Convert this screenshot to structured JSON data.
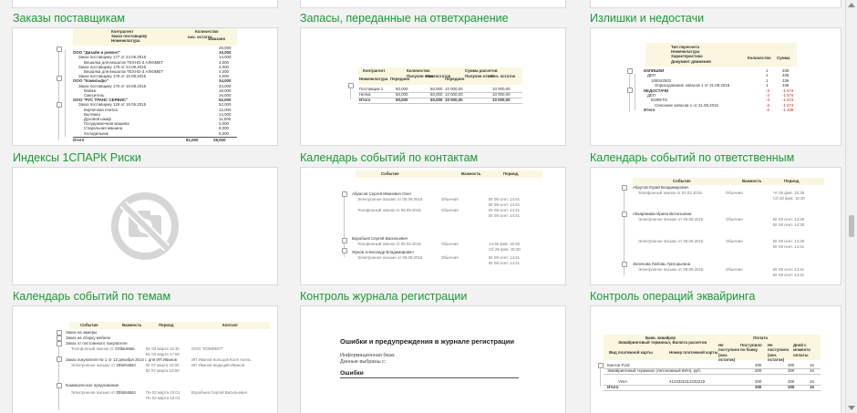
{
  "tiles": [
    {
      "title": "Заказы поставщикам"
    },
    {
      "title": "Запасы, переданные на ответхранение"
    },
    {
      "title": "Излишки и недостачи"
    },
    {
      "title": "Индексы 1СПАРК Риски"
    },
    {
      "title": "Календарь событий по контактам"
    },
    {
      "title": "Календарь событий по ответственным"
    },
    {
      "title": "Календарь событий по темам"
    },
    {
      "title": "Контроль журнала регистрации"
    },
    {
      "title": "Контроль операций эквайринга"
    }
  ],
  "orders": {
    "header": [
      "Контрагент",
      "Заказ поставщику",
      "Номенклатура",
      "Количество",
      "нач. остаток",
      "заказано"
    ],
    "rows": [
      {
        "t": "",
        "v1": "",
        "v2": "28,000"
      },
      {
        "t": "ООО \"Дизайн и ремонт\"",
        "v1": "",
        "v2": "10,000"
      },
      {
        "t": "Заказ поставщику 177 от 24.09.2015",
        "v1": "",
        "v2": "14,000"
      },
      {
        "t": "Вешалка для вешалок ТЕХНО-3 АЛЮМЕТ",
        "v1": "",
        "v2": "4,000"
      },
      {
        "t": "Заказ поставщику 179 от 24.09.2015",
        "v1": "",
        "v2": "4,000"
      },
      {
        "t": "Вешалка для вешалок ТЕХНО-3 АЛЮМЕТ",
        "v1": "",
        "v2": "4,000"
      },
      {
        "t": "Заказ поставщику 178 от 10.08.2015",
        "v1": "",
        "v2": "4,000"
      },
      {
        "t": "ООО \"Комильфо\"",
        "v1": "",
        "v2": "34,000"
      },
      {
        "t": "Заказ поставщику 176 от 10.08.2015",
        "v1": "",
        "v2": "34,000"
      },
      {
        "t": "Мойка",
        "v1": "",
        "v2": "18,000"
      },
      {
        "t": "Смеситель",
        "v1": "",
        "v2": "16,000"
      },
      {
        "t": "ООО \"РУС ТРАНС СЕРВИС\"",
        "v1": "",
        "v2": "52,000"
      },
      {
        "t": "Заказ поставщику 128 от 16.06.2015",
        "v1": "",
        "v2": "52,000"
      },
      {
        "t": "Кирпичная плитка",
        "v1": "",
        "v2": "12,000"
      },
      {
        "t": "Вытяжка",
        "v1": "",
        "v2": "14,000"
      },
      {
        "t": "Духовой шкаф",
        "v1": "",
        "v2": "11,000"
      },
      {
        "t": "Посудомоечная машина",
        "v1": "",
        "v2": "2,000"
      },
      {
        "t": "Стиральная машина",
        "v1": "",
        "v2": "8,000"
      },
      {
        "t": "Холодильник",
        "v1": "",
        "v2": "5,000"
      }
    ],
    "total_label": "Итого",
    "total_1": "81,000",
    "total_2": "28,000"
  },
  "storage": {
    "headers": [
      "Контрагент",
      "Номенклатура",
      "Количество",
      "Передано",
      "Получен ответ",
      "Кон. остаток",
      "Сумма расчетов",
      "Передано",
      "Получен ответ",
      "Кон. остаток"
    ],
    "rows": [
      {
        "t": "Поставщик 1",
        "c": [
          "50,000",
          "",
          "50,000",
          "10 000,00",
          "",
          "10 000,00"
        ]
      },
      {
        "t": "Нелка",
        "c": [
          "50,000",
          "",
          "50,000",
          "10 000,00",
          "",
          "10 000,00"
        ]
      },
      {
        "t": "Итого",
        "c": [
          "50,000",
          "",
          "50,000",
          "10 000,00",
          "",
          "10 000,00"
        ]
      }
    ]
  },
  "surplus": {
    "headers": [
      "Тип пересчета",
      "Номенклатура",
      "Характеристика",
      "Документ движения",
      "Количество",
      "Сумма"
    ],
    "rows": [
      {
        "t": "ИЗЛИШКИ",
        "q": "1",
        "s": "336",
        "neg": false
      },
      {
        "t": "ДЕП",
        "q": "1",
        "s": "336",
        "neg": false
      },
      {
        "t": "100042503",
        "q": "1",
        "s": "336",
        "neg": false
      },
      {
        "t": "Оприходование запасов 1 от 21.08.2015",
        "q": "1",
        "s": "336",
        "neg": false
      },
      {
        "t": "НЕДОСТАЧИ",
        "q": "-3",
        "s": "-1 674",
        "neg": true
      },
      {
        "t": "ДЕП",
        "q": "-3",
        "s": "-1 674",
        "neg": true
      },
      {
        "t": "КОФЕТО",
        "q": "-3",
        "s": "-1 674",
        "neg": true
      },
      {
        "t": "Списание запасов 1 от 21.08.2015",
        "q": "-3",
        "s": "-1 674",
        "neg": true
      },
      {
        "t": "Итого",
        "q": "-2",
        "s": "-1 338",
        "neg": true
      }
    ]
  },
  "contacts": {
    "headers": [
      "Событие",
      "Важность",
      "Период"
    ],
    "rows": [
      {
        "t": "Абрасов Сергей Иванович Олег",
        "i": "",
        "p": ""
      },
      {
        "t": "Электронное письмо от 05.09.2015",
        "i": "Обычная",
        "p": "Вт 08 сент. 14:41"
      },
      {
        "t": "",
        "i": "",
        "p": "Вт 08 сент. 14:41"
      },
      {
        "t": "Телефонный звонок от 05.09.2015",
        "i": "Обычная",
        "p": "Вт 08 сент. 14:41"
      },
      {
        "t": "",
        "i": "",
        "p": "Вт 08 сент. 14:41"
      },
      {
        "t": "Воробьев Сергей Васильевич",
        "i": "",
        "p": ""
      },
      {
        "t": "Телефонный звонок от 05.02.2015",
        "i": "Обычная",
        "p": "14:35 фев. 15:30"
      },
      {
        "t": "",
        "i": "",
        "p": "Сб 28 фев. 15:30"
      },
      {
        "t": "Жуков Александр Владимирович",
        "i": "",
        "p": ""
      },
      {
        "t": "Электронное письмо от 09.09.2015",
        "i": "Обычная",
        "p": "Вт 08 сент. 14:41"
      },
      {
        "t": "",
        "i": "",
        "p": "Вт 08 сент. 14:41"
      }
    ]
  },
  "responsible": {
    "headers": [
      "Событие",
      "Важность",
      "Период"
    ],
    "rows": [
      {
        "t": "Абрутов Юрий Владимирович",
        "i": "",
        "p": ""
      },
      {
        "t": "Телефонный звонок от 02.02.2015",
        "i": "Обычная",
        "p": "Чт 05 фев. 15:35"
      },
      {
        "t": "",
        "i": "",
        "p": "Сб 28 фев. 15:30"
      },
      {
        "t": "Абкарямова Ирина Витальевна",
        "i": "",
        "p": ""
      },
      {
        "t": "Электронное письмо от 09.09.2015",
        "i": "Обычная",
        "p": "Вт 08 сент. 14:35"
      },
      {
        "t": "",
        "i": "",
        "p": "Вт 08 сент. 14:35"
      },
      {
        "t": "Электронное письмо от 09.09.2015",
        "i": "Обычная",
        "p": "Вт 08 сент. 14:35"
      },
      {
        "t": "",
        "i": "",
        "p": "Вт 08 сент. 14:41"
      },
      {
        "t": "Зеленова Любовь Григорьевна",
        "i": "",
        "p": ""
      },
      {
        "t": "Электронное письмо от 09.09.2015",
        "i": "Обычная",
        "p": "Вт 08 сент. 14:41"
      },
      {
        "t": "",
        "i": "",
        "p": "Вт 08 сент. 14:41"
      }
    ]
  },
  "topics": {
    "headers": [
      "Событие",
      "Важность",
      "Период",
      "Контакт"
    ],
    "rows": [
      {
        "t": "Заказ на замеры",
        "i": "",
        "p": "",
        "c": ""
      },
      {
        "t": "Заказ на сборку мебели",
        "i": "",
        "p": "",
        "c": ""
      },
      {
        "t": "Заказ от постоянного покупателя",
        "i": "",
        "p": "",
        "c": ""
      },
      {
        "t": "Телефонный звонок от 07.03.2015",
        "i": "Обычная",
        "p": "Вс 03 марта 15:30",
        "c": "ООО \"КОМЛЕКТ\""
      },
      {
        "t": "",
        "i": "",
        "p": "Вс 03 марта 17:00",
        "c": ""
      },
      {
        "t": "Заказ покупателя № 1 от 12 декабря 2014 г. для ИП Иванов",
        "i": "",
        "p": "",
        "c": "ИП Иванов Кольцов Коля Асель"
      },
      {
        "t": "Электронное письмо от 10.07.2015",
        "i": "Обычная",
        "p": "Вт 07 марта 10:00",
        "c": "ИП Иванов ведущий Иванов"
      },
      {
        "t": "",
        "i": "",
        "p": "Вт 07 марта 10:00",
        "c": ""
      },
      {
        "t": "Коммерческое предложение",
        "i": "",
        "p": "",
        "c": ""
      },
      {
        "t": "Электронное письмо от 02.03.2015",
        "i": "Обычная",
        "p": "Пн 02 марта 10:01",
        "c": "Воробьев Сергей Васильевич"
      },
      {
        "t": "",
        "i": "",
        "p": "Пн 02 марта 10:01",
        "c": ""
      }
    ]
  },
  "journal": {
    "heading": "Ошибки и предупреждения в журнале регистрации",
    "line1": "Информационная база:",
    "line2": "Данные выбраны с:",
    "section": "Ошибки"
  },
  "acquiring": {
    "headers": [
      "Банк, эквайрер",
      "Эквайринговый терминал, Валюта расчетов",
      "Вид платежной карты",
      "Номер платежной карты",
      "Оплата",
      "Не поступило (нач. остаток)",
      "Поступило по банку",
      "Не поступило (кон. остаток)",
      "Дней с момента оплаты"
    ],
    "rows": [
      {
        "t": "Кантон Ford",
        "c": [
          "",
          "",
          "300",
          "",
          "300",
          "16"
        ]
      },
      {
        "t": "Эквайринговый терминал (Автономный КИН), руб.",
        "c": [
          "",
          "",
          "300",
          "",
          "300",
          "16"
        ]
      },
      {
        "t": "VISA",
        "c": [
          "4123321012332219",
          "",
          "300",
          "",
          "300",
          "16"
        ]
      },
      {
        "t": "Итого",
        "c": [
          "",
          "",
          "300",
          "",
          "300",
          "16"
        ]
      }
    ]
  }
}
